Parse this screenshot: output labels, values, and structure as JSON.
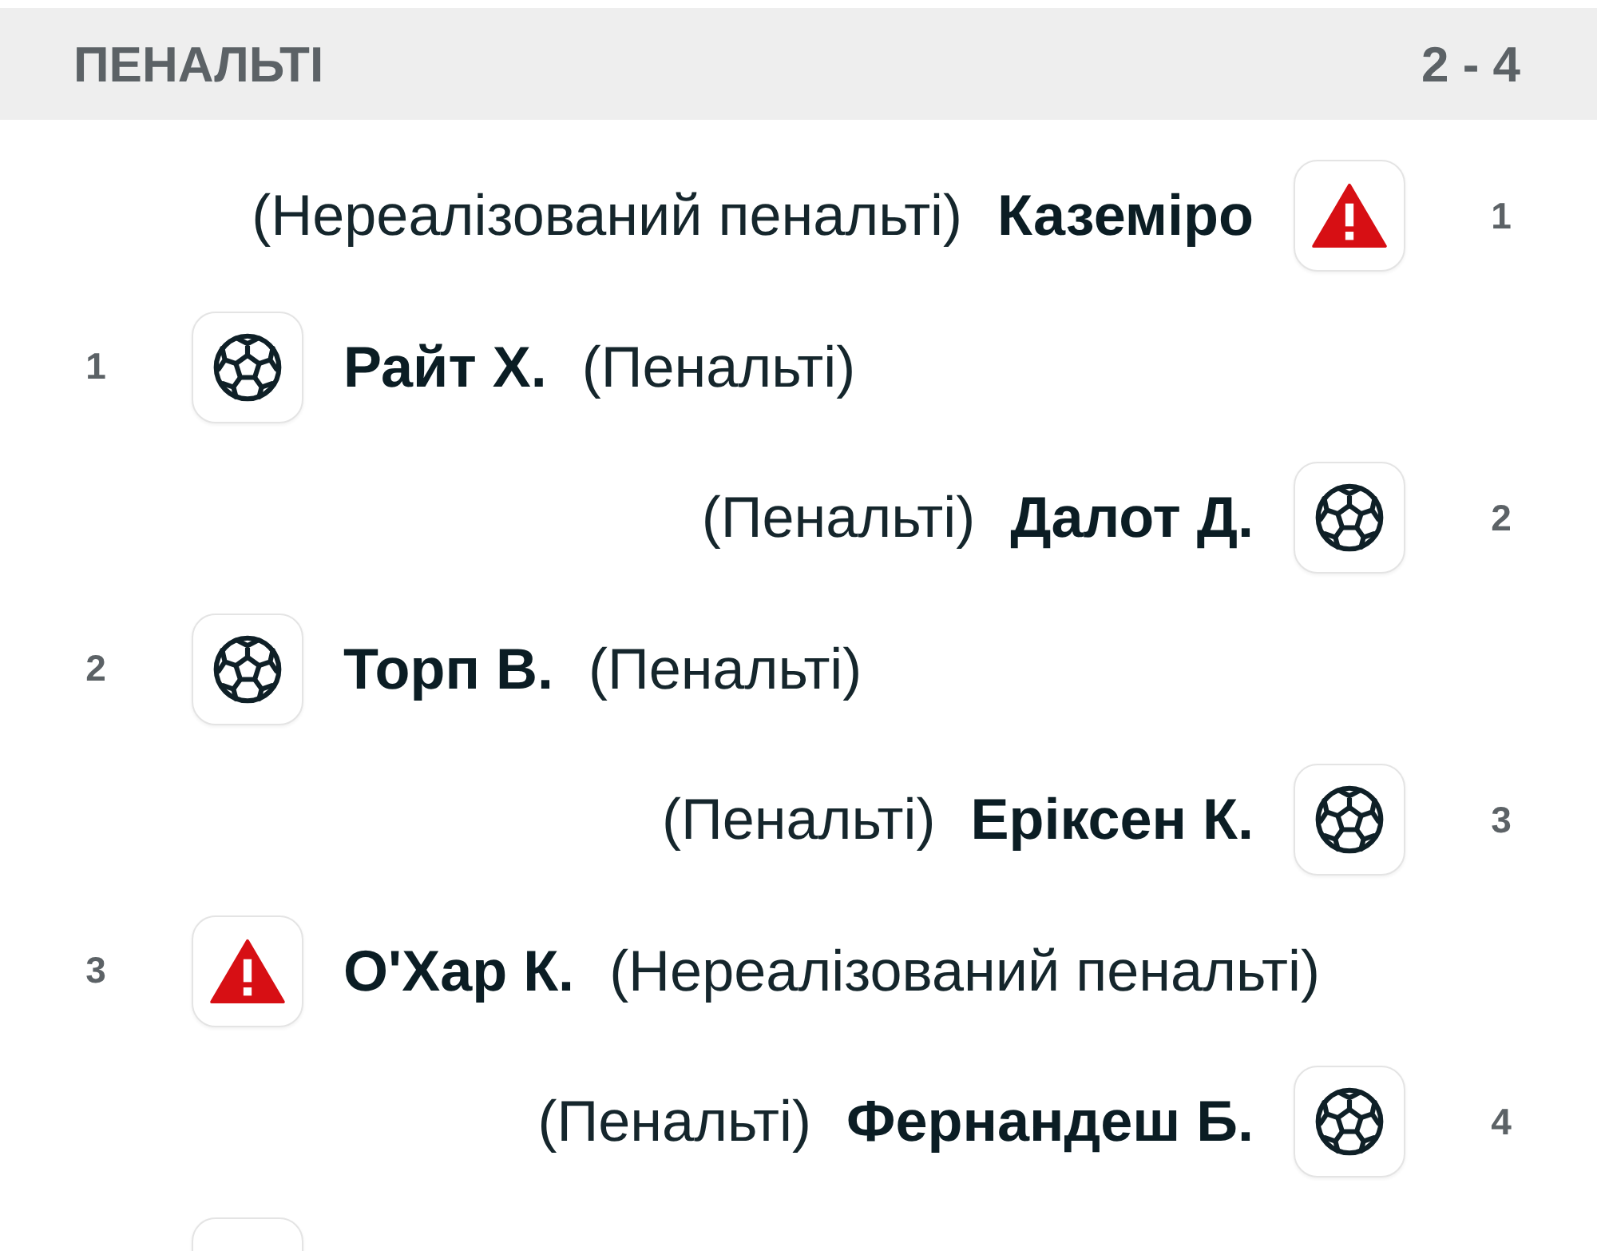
{
  "section": {
    "title": "ПЕНАЛЬТІ",
    "score": "2 - 4"
  },
  "penalties": [
    {
      "kind": "away",
      "missed": true,
      "note": "(Нереалізований пенальті)",
      "player": "Каземіро",
      "count": "1"
    },
    {
      "kind": "home",
      "missed": false,
      "note": "(Пенальті)",
      "player": "Райт Х.",
      "count": "1"
    },
    {
      "kind": "away",
      "missed": false,
      "note": "(Пенальті)",
      "player": "Далот Д.",
      "count": "2"
    },
    {
      "kind": "home",
      "missed": false,
      "note": "(Пенальті)",
      "player": "Торп В.",
      "count": "2"
    },
    {
      "kind": "away",
      "missed": false,
      "note": "(Пенальті)",
      "player": "Еріксен К.",
      "count": "3"
    },
    {
      "kind": "home",
      "missed": true,
      "note": "(Нереалізований пенальті)",
      "player": "О'Хар К.",
      "count": "3"
    },
    {
      "kind": "away",
      "missed": false,
      "note": "(Пенальті)",
      "player": "Фернандеш Б.",
      "count": "4"
    },
    {
      "kind": "home"
    }
  ]
}
